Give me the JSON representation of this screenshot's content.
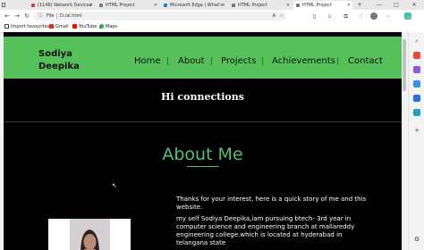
{
  "browser": {
    "tabs": [
      {
        "label": "(1148) Network Devices",
        "active": false,
        "fav_color": "#d23b3b"
      },
      {
        "label": "HTML Project",
        "active": false,
        "fav_color": "#777"
      },
      {
        "label": "Microsoft Edge | What's",
        "active": false,
        "fav_color": "#1f7fd0"
      },
      {
        "label": "HTML Project",
        "active": false,
        "fav_color": "#777"
      },
      {
        "label": "HTML Project",
        "active": true,
        "fav_color": "#777"
      }
    ],
    "address": {
      "prefix": "File",
      "url": "D:/al.html"
    },
    "favorites": [
      {
        "label": "Import favourites",
        "icon": "import-icon",
        "color": "#444"
      },
      {
        "label": "Gmail",
        "icon": "gmail-icon",
        "color": "#d93025"
      },
      {
        "label": "YouTube",
        "icon": "youtube-icon",
        "color": "#ff0000"
      },
      {
        "label": "Maps",
        "icon": "maps-icon",
        "color": "#34a853"
      }
    ]
  },
  "site": {
    "logo": {
      "line1": "Sodiya",
      "line2": "Deepika"
    },
    "nav": [
      "Home",
      "About",
      "Projects",
      "Achievements",
      "Contact"
    ],
    "greeting": "Hi connections",
    "about_title": "About Me",
    "intro": "Thanks for your interest, here is a quick story of me and this website.",
    "story": "my self Sodiya Deepika,iam pursuing btech- 3rd year in computer science and engineering branch at mallareddy engineering college.which is located at hyderabad in telangana state"
  },
  "colors": {
    "nav_green": "#56c15b",
    "accent_green": "#4fbf74",
    "page_bg": "#000000"
  }
}
